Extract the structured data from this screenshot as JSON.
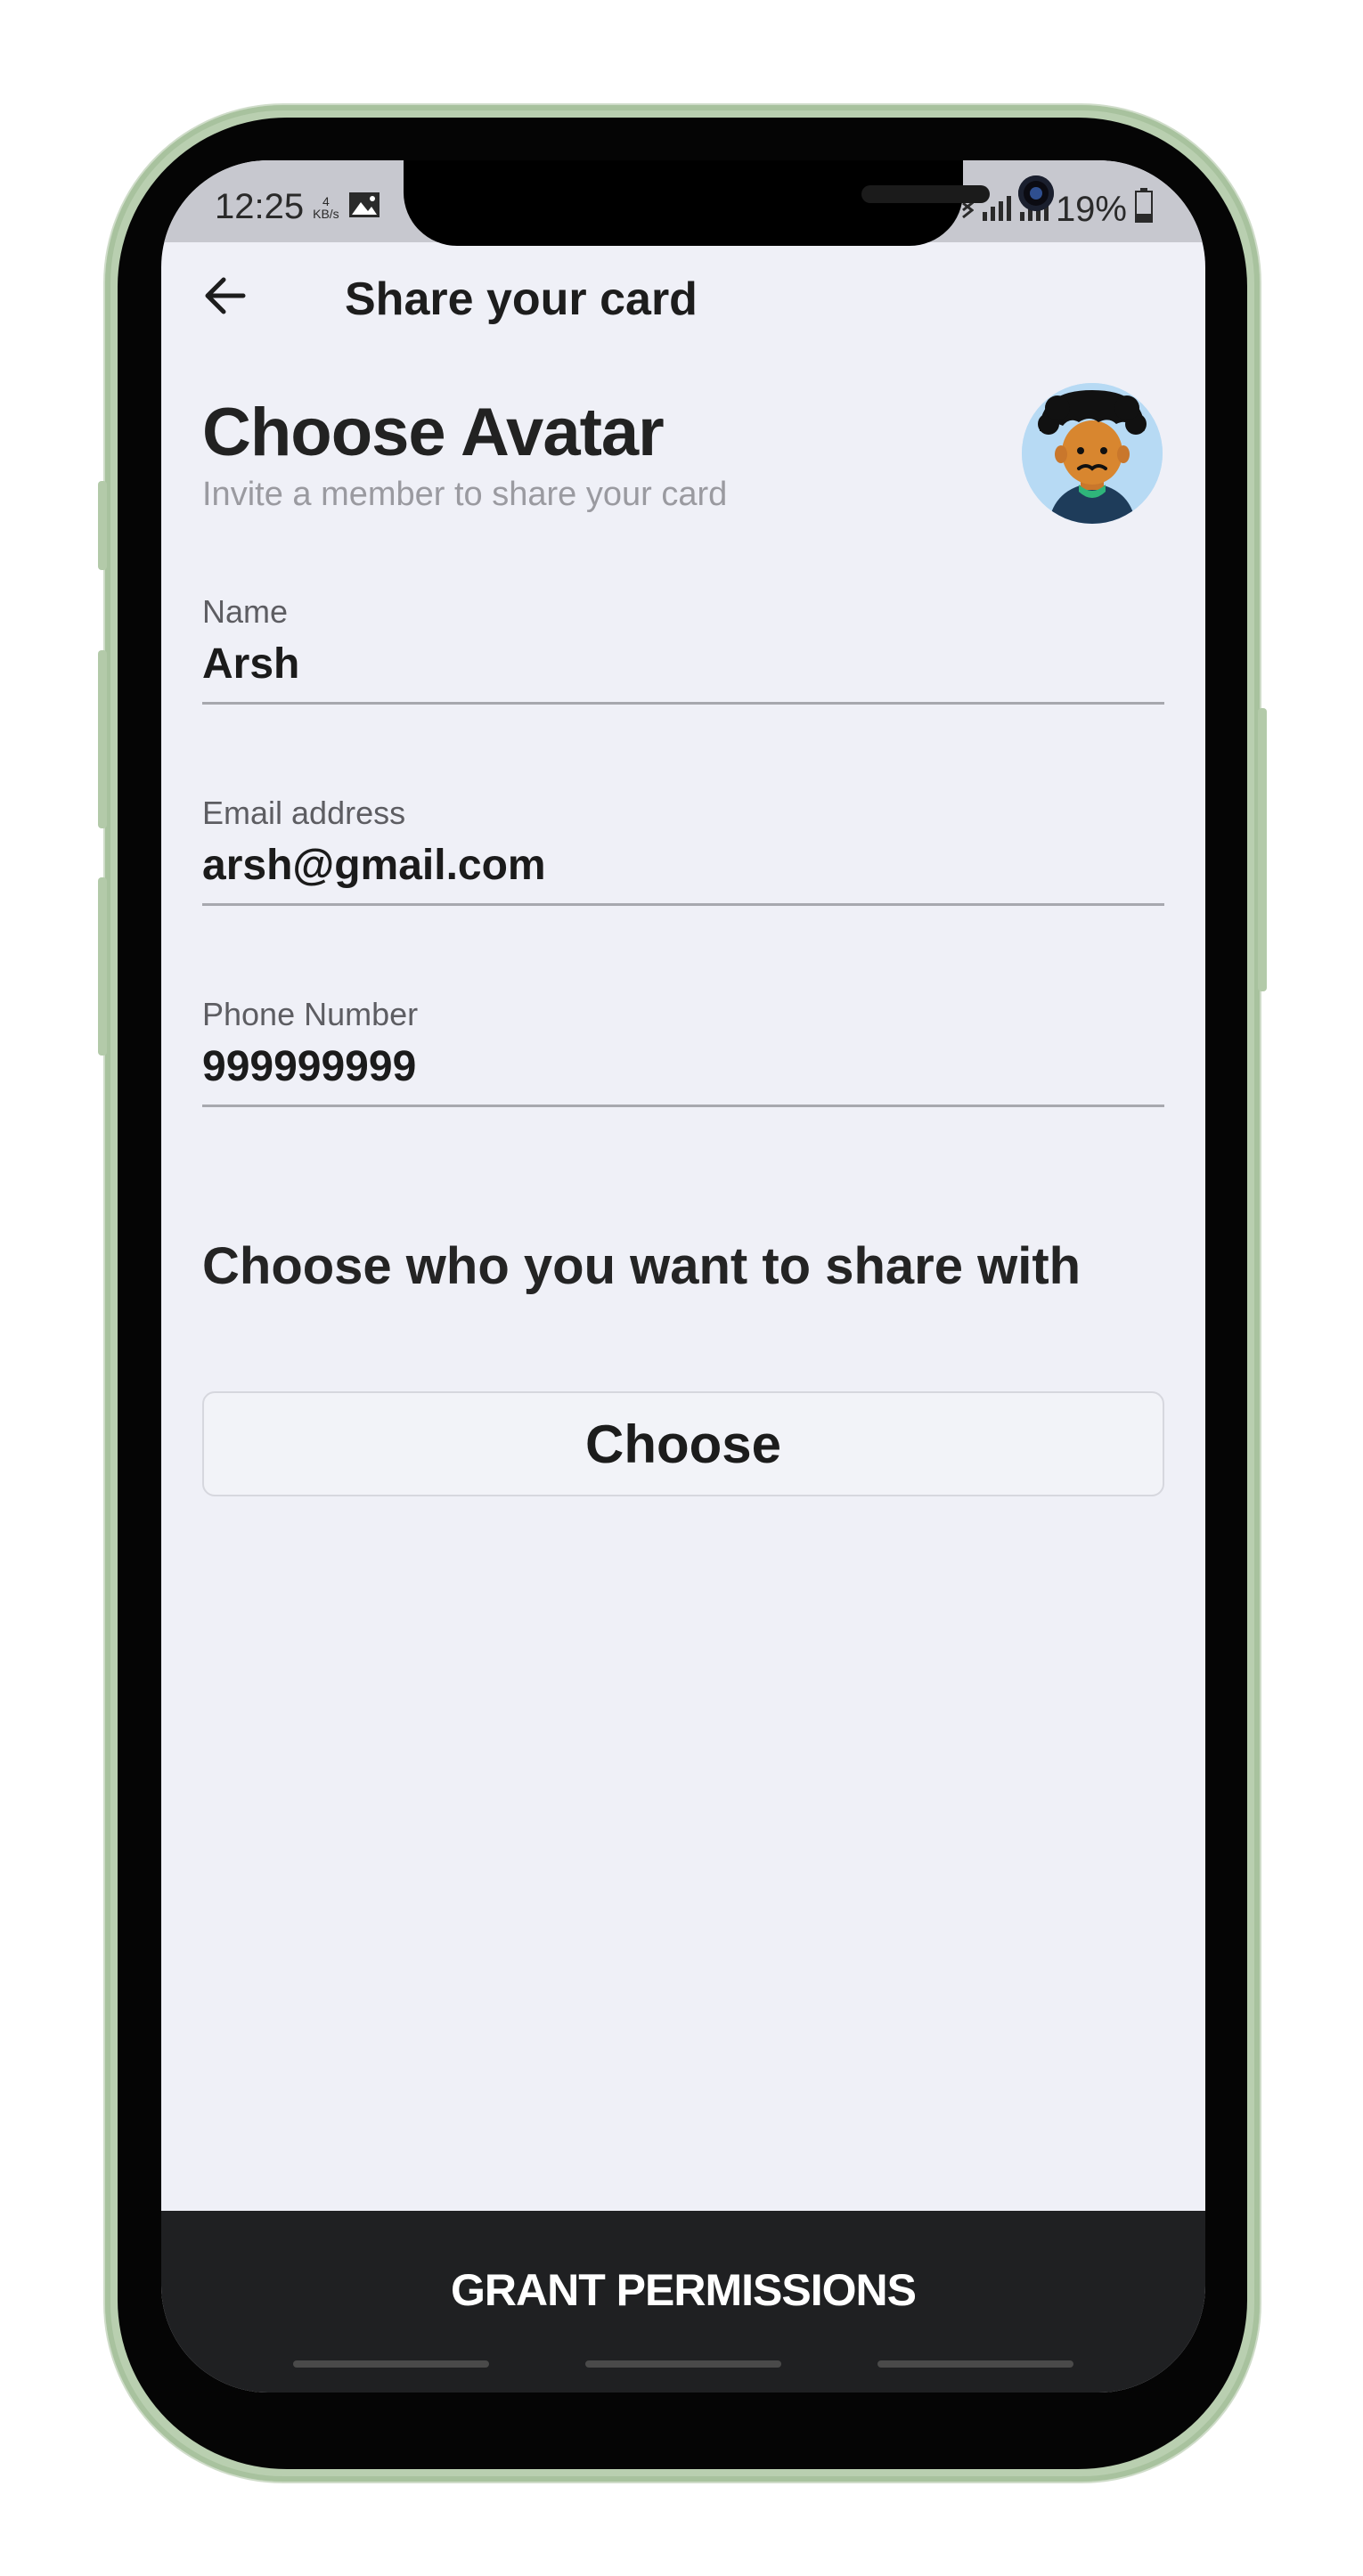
{
  "status_bar": {
    "time": "12:25",
    "net_speed_value": "4",
    "net_speed_unit": "KB/s",
    "battery": "19%"
  },
  "header": {
    "title": "Share your card"
  },
  "page": {
    "title": "Choose Avatar",
    "subtitle": "Invite a member to share your card"
  },
  "form": {
    "name": {
      "label": "Name",
      "value": "Arsh"
    },
    "email": {
      "label": "Email address",
      "value": "arsh@gmail.com"
    },
    "phone": {
      "label": "Phone Number",
      "value": "999999999"
    }
  },
  "share": {
    "heading": "Choose who you want to share with",
    "choose_label": "Choose"
  },
  "footer": {
    "grant_label": "GRANT PERMISSIONS"
  },
  "colors": {
    "screen_bg": "#eff0f7",
    "footer_bg": "#1f2022",
    "phone_frame": "#b9cfb0"
  }
}
